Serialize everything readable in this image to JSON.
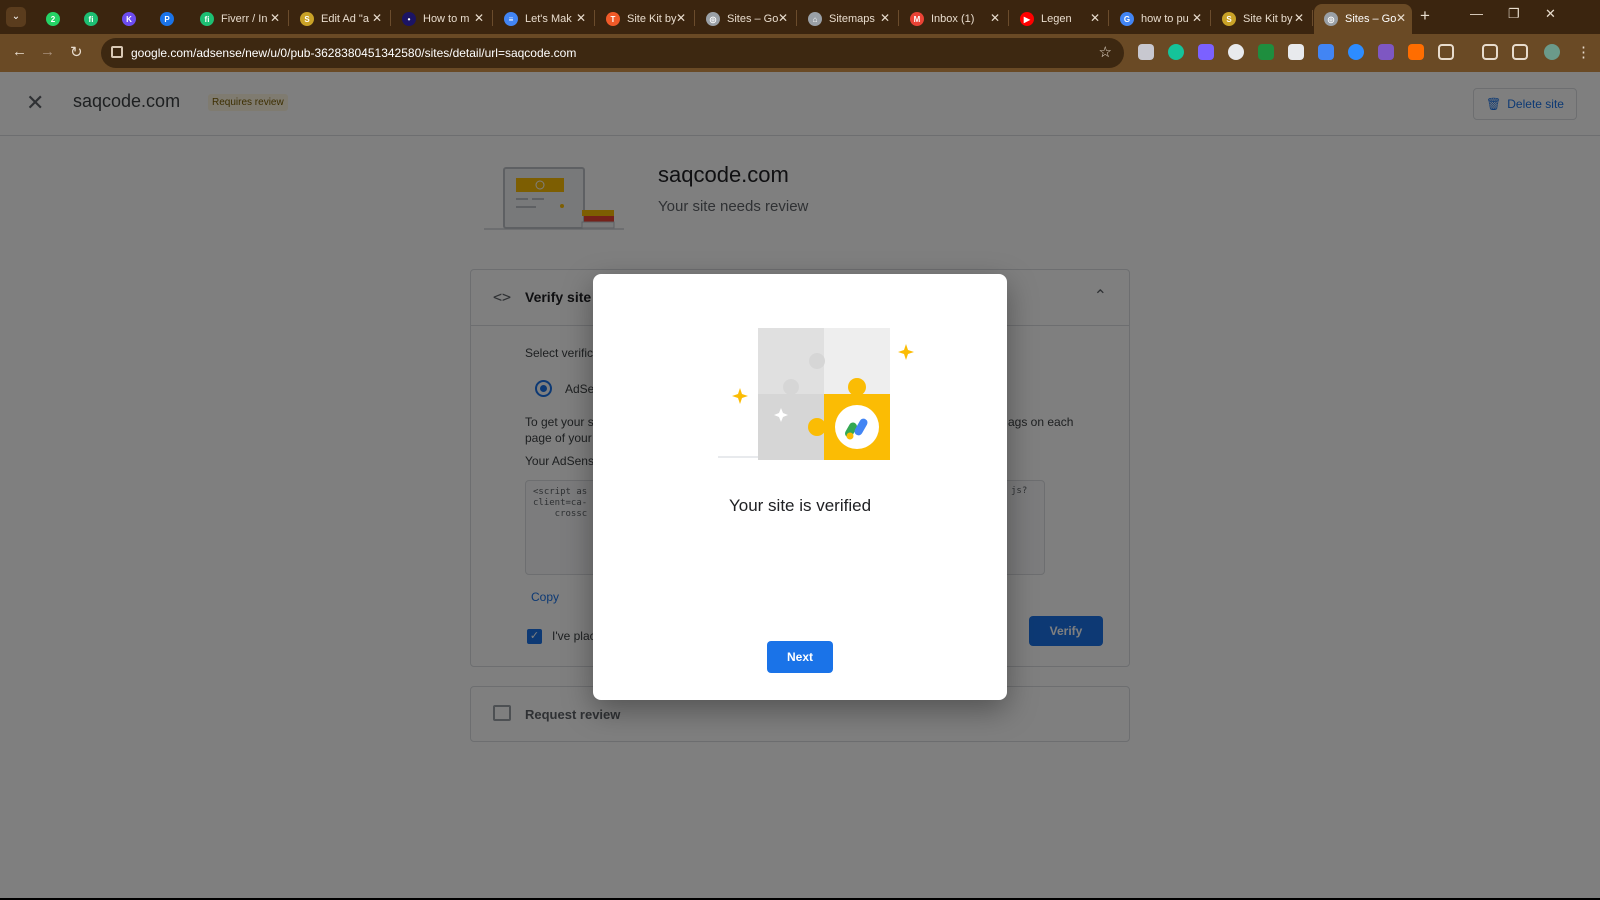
{
  "browser": {
    "tabs": [
      {
        "title": "",
        "favicon_color": "#25d366",
        "favicon_text": "2"
      },
      {
        "title": "",
        "favicon_color": "#1dbf73",
        "favicon_text": "fi"
      },
      {
        "title": "",
        "favicon_color": "#6c4cf1",
        "favicon_text": "K"
      },
      {
        "title": "",
        "favicon_color": "#1a73e8",
        "favicon_text": "P"
      },
      {
        "title": "Fiverr / In",
        "favicon_color": "#1dbf73",
        "favicon_text": "fi"
      },
      {
        "title": "Edit Ad \"a",
        "favicon_color": "#c9a227",
        "favicon_text": "S"
      },
      {
        "title": "How to m",
        "favicon_color": "#1b1464",
        "favicon_text": "•"
      },
      {
        "title": "Let's Mak",
        "favicon_color": "#4285f4",
        "favicon_text": "≡"
      },
      {
        "title": "Site Kit by",
        "favicon_color": "#f05a28",
        "favicon_text": "T"
      },
      {
        "title": "Sites – Go",
        "favicon_color": "#9aa0a6",
        "favicon_text": "◎"
      },
      {
        "title": "Sitemaps",
        "favicon_color": "#9aa0a6",
        "favicon_text": "⌂"
      },
      {
        "title": "Inbox (1)",
        "favicon_color": "#ea4335",
        "favicon_text": "M"
      },
      {
        "title": "Legen",
        "favicon_color": "#ff0000",
        "favicon_text": "▶"
      },
      {
        "title": "how to pu",
        "favicon_color": "#4285f4",
        "favicon_text": "G"
      },
      {
        "title": "Site Kit by",
        "favicon_color": "#c9a227",
        "favicon_text": "S"
      },
      {
        "title": "Sites – Go",
        "favicon_color": "#9aa0a6",
        "favicon_text": "◎"
      }
    ],
    "active_tab_index": 15,
    "url": "google.com/adsense/new/u/0/pub-3628380451342580/sites/detail/url=saqcode.com"
  },
  "header": {
    "site_name": "saqcode.com",
    "badge": "Requires review",
    "delete_label": "Delete site"
  },
  "hero": {
    "title": "saqcode.com",
    "subtitle": "Your site needs review"
  },
  "verify_card": {
    "title": "Verify site o",
    "select_label": "Select verific",
    "radio_label": "AdSe",
    "instructions_left": "To get your s",
    "instructions_left2": "page of your",
    "instructions_right": "ags on each",
    "code_label": "Your AdSens",
    "code_snippet": "<script as\nclient=ca-\n    crossc",
    "code_snippet_tail": "js?",
    "copy_label": "Copy",
    "checkbox_label": "I've plac",
    "verify_label": "Verify"
  },
  "request_card": {
    "title": "Request review"
  },
  "dialog": {
    "title": "Your site is verified",
    "next_label": "Next"
  },
  "colors": {
    "accent": "#1a73e8",
    "chrome_bg": "#3b250f",
    "toolbar_bg": "#6a4a25",
    "illustration_yellow": "#fbbc04"
  }
}
